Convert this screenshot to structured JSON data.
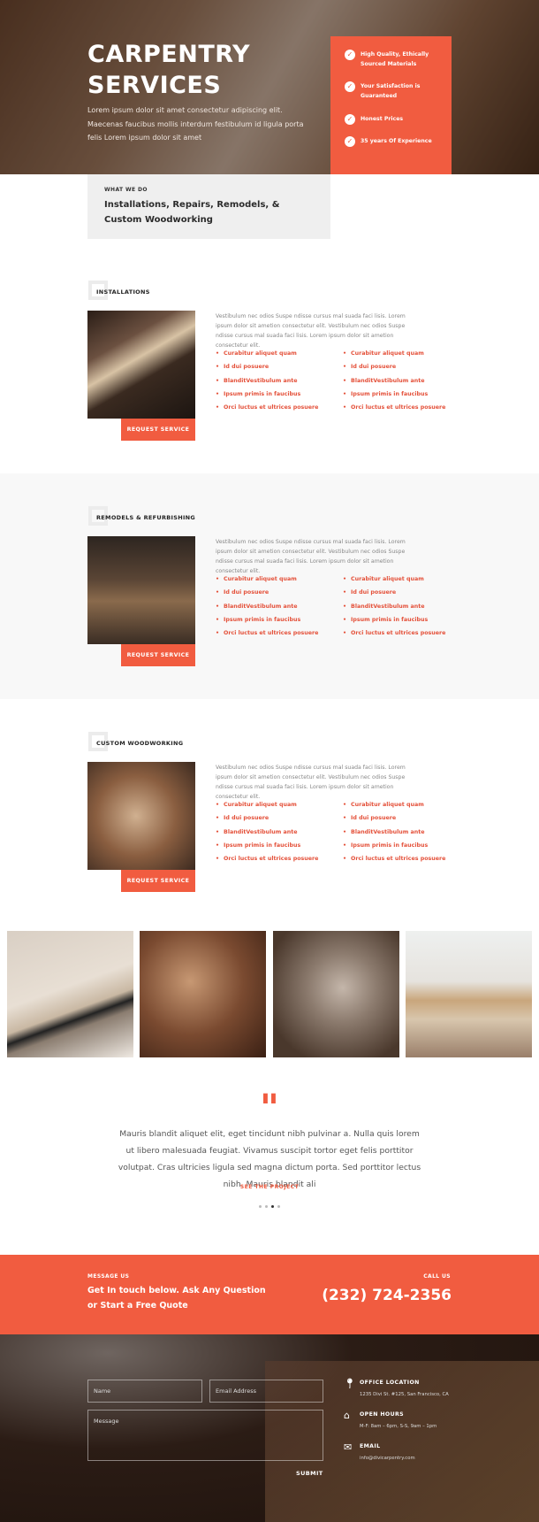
{
  "hero": {
    "title_line1": "CARPENTRY",
    "title_line2": "SERVICES",
    "text": "Lorem ipsum dolor sit amet consectetur adipiscing elit. Maecenas faucibus mollis interdum festibulum id ligula porta felis Lorem ipsum dolor sit amet",
    "features": [
      {
        "icon": "check-circle-icon",
        "label": "High Quality, Ethically Sourced Materials"
      },
      {
        "icon": "check-circle-icon",
        "label": "Your Satisfaction is Guaranteed"
      },
      {
        "icon": "check-circle-icon",
        "label": "Honest Prices"
      },
      {
        "icon": "check-circle-icon",
        "label": "35 years Of Experience"
      }
    ]
  },
  "what_we_do": {
    "kicker": "WHAT WE DO",
    "title": "Installations, Repairs, Remodels, & Custom Woodworking"
  },
  "services": [
    {
      "title": "INSTALLATIONS",
      "text": "Vestibulum nec odios Suspe ndisse cursus mal suada faci lisis. Lorem ipsum dolor sit ametion consectetur elit. Vestibulum nec odios Suspe ndisse cursus mal suada faci lisis. Lorem ipsum dolor sit ametion consectetur elit.",
      "list_left": [
        "Curabitur aliquet quam",
        "Id dui posuere",
        "BlanditVestibulum ante",
        "Ipsum primis in faucibus",
        "Orci luctus et ultrices posuere"
      ],
      "list_right": [
        "Curabitur aliquet quam",
        "Id dui posuere",
        "BlanditVestibulum ante",
        "Ipsum primis in faucibus",
        "Orci luctus et ultrices posuere"
      ],
      "button": "REQUEST SERVICE"
    },
    {
      "title": "REMODELS & REFURBISHING",
      "text": "Vestibulum nec odios Suspe ndisse cursus mal suada faci lisis. Lorem ipsum dolor sit ametion consectetur elit. Vestibulum nec odios Suspe ndisse cursus mal suada faci lisis. Lorem ipsum dolor sit ametion consectetur elit.",
      "list_left": [
        "Curabitur aliquet quam",
        "Id dui posuere",
        "BlanditVestibulum ante",
        "Ipsum primis in faucibus",
        "Orci luctus et ultrices posuere"
      ],
      "list_right": [
        "Curabitur aliquet quam",
        "Id dui posuere",
        "BlanditVestibulum ante",
        "Ipsum primis in faucibus",
        "Orci luctus et ultrices posuere"
      ],
      "button": "REQUEST SERVICE"
    },
    {
      "title": "CUSTOM WOODWORKING",
      "text": "Vestibulum nec odios Suspe ndisse cursus mal suada faci lisis. Lorem ipsum dolor sit ametion consectetur elit. Vestibulum nec odios Suspe ndisse cursus mal suada faci lisis. Lorem ipsum dolor sit ametion consectetur elit.",
      "list_left": [
        "Curabitur aliquet quam",
        "Id dui posuere",
        "BlanditVestibulum ante",
        "Ipsum primis in faucibus",
        "Orci luctus et ultrices posuere"
      ],
      "list_right": [
        "Curabitur aliquet quam",
        "Id dui posuere",
        "BlanditVestibulum ante",
        "Ipsum primis in faucibus",
        "Orci luctus et ultrices posuere"
      ],
      "button": "REQUEST SERVICE"
    }
  ],
  "testimonial": {
    "quote_mark": "\"",
    "text": "Mauris blandit aliquet elit, eget tincidunt nibh pulvinar a. Nulla quis lorem ut libero malesuada feugiat. Vivamus suscipit tortor eget felis porttitor volutpat. Cras ultricies ligula sed magna dictum porta. Sed porttitor lectus nibh. Mauris blandit ali",
    "link": "SEE THE PROJECT",
    "slide_count": 4,
    "active_slide": 3
  },
  "cta": {
    "kicker": "MESSAGE US",
    "text": "Get In touch below. Ask Any Question or Start a Free Quote",
    "call_kicker": "CALL US",
    "phone": "(232) 724-2356"
  },
  "form": {
    "name_placeholder": "Name",
    "email_placeholder": "Email Address",
    "message_placeholder": "Message",
    "submit": "SUBMIT"
  },
  "contact_info": [
    {
      "icon": "map-pin-icon",
      "heading": "OFFICE LOCATION",
      "text": "1235 Divi St. #125, San Francisco, CA"
    },
    {
      "icon": "home-icon",
      "heading": "OPEN HOURS",
      "text": "M-F: 8am – 6pm, S-S, 9am – 1pm"
    },
    {
      "icon": "envelope-icon",
      "heading": "EMAIL",
      "text": "info@divicarpentry.com"
    }
  ],
  "colors": {
    "accent": "#f15c40",
    "light_gray": "#efefef"
  }
}
